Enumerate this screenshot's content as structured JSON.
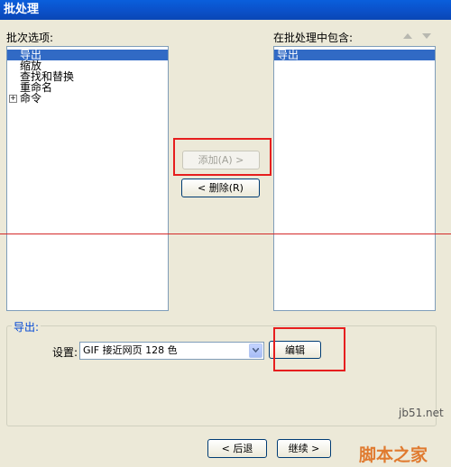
{
  "window": {
    "title": "批处理"
  },
  "batch_options": {
    "label": "批次选项:",
    "items": [
      {
        "label": "导出"
      },
      {
        "label": "缩放"
      },
      {
        "label": "查找和替换"
      },
      {
        "label": "重命名"
      },
      {
        "label": "命令",
        "toggle": "+"
      }
    ]
  },
  "included": {
    "label": "在批处理中包含:",
    "items": [
      {
        "label": "导出"
      }
    ]
  },
  "buttons": {
    "add": "添加(A) >",
    "remove": "< 删除(R)",
    "edit": "编辑",
    "back": "< 后退",
    "next": "继续 >"
  },
  "export_group": {
    "legend": "导出:",
    "settings_label": "设置:",
    "settings_value": "GIF 接近网页 128 色"
  },
  "watermark": {
    "site": "jb51.net",
    "brand": "脚本之家"
  },
  "colors": {
    "annotation_red": "#e61e1e",
    "selection": "#316ac5",
    "title_bar": "#0b4fc7"
  }
}
